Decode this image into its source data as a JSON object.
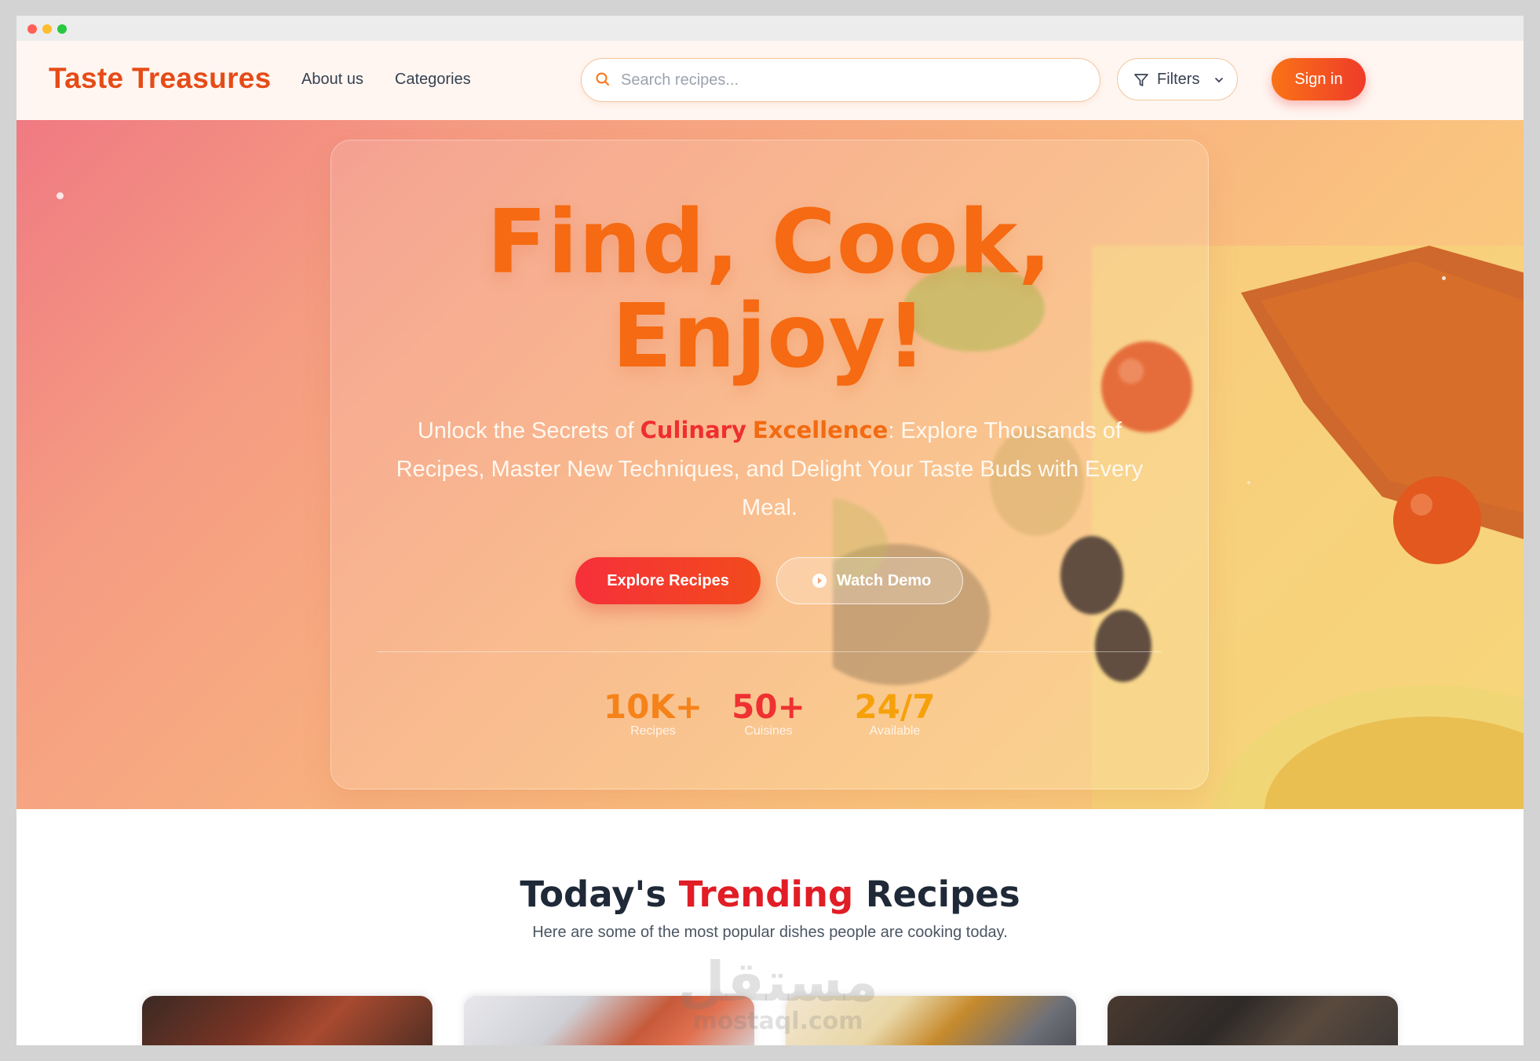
{
  "navbar": {
    "logo": "Taste Treasures",
    "links": [
      "About us",
      "Categories"
    ],
    "search_placeholder": "Search recipes...",
    "filters_label": "Filters",
    "signin_label": "Sign in"
  },
  "hero": {
    "headline_line1": "Find, Cook,",
    "headline_line2": "Enjoy!",
    "subtitle_before": "Unlock the Secrets of ",
    "subtitle_highlight1": "Culinary",
    "subtitle_highlight2": "Excellence",
    "subtitle_after": ": Explore Thousands of Recipes, Master New Techniques, and Delight Your Taste Buds with Every Meal.",
    "explore_label": "Explore Recipes",
    "demo_label": "Watch Demo",
    "stats": [
      {
        "value": "10K+",
        "label": "Recipes"
      },
      {
        "value": "50+",
        "label": "Cuisines"
      },
      {
        "value": "24/7",
        "label": "Available"
      }
    ]
  },
  "trending": {
    "title_part1": "Today's ",
    "title_highlight": "Trending",
    "title_part2": " Recipes",
    "subtitle": "Here are some of the most popular dishes people are cooking today."
  },
  "watermark": {
    "arabic": "مستقل",
    "latin": "mostaql.com"
  },
  "colors": {
    "brand": "#e64b17",
    "accent_red": "#ef2f2f",
    "accent_orange": "#f56a12",
    "accent_yellow": "#f6a10b"
  }
}
